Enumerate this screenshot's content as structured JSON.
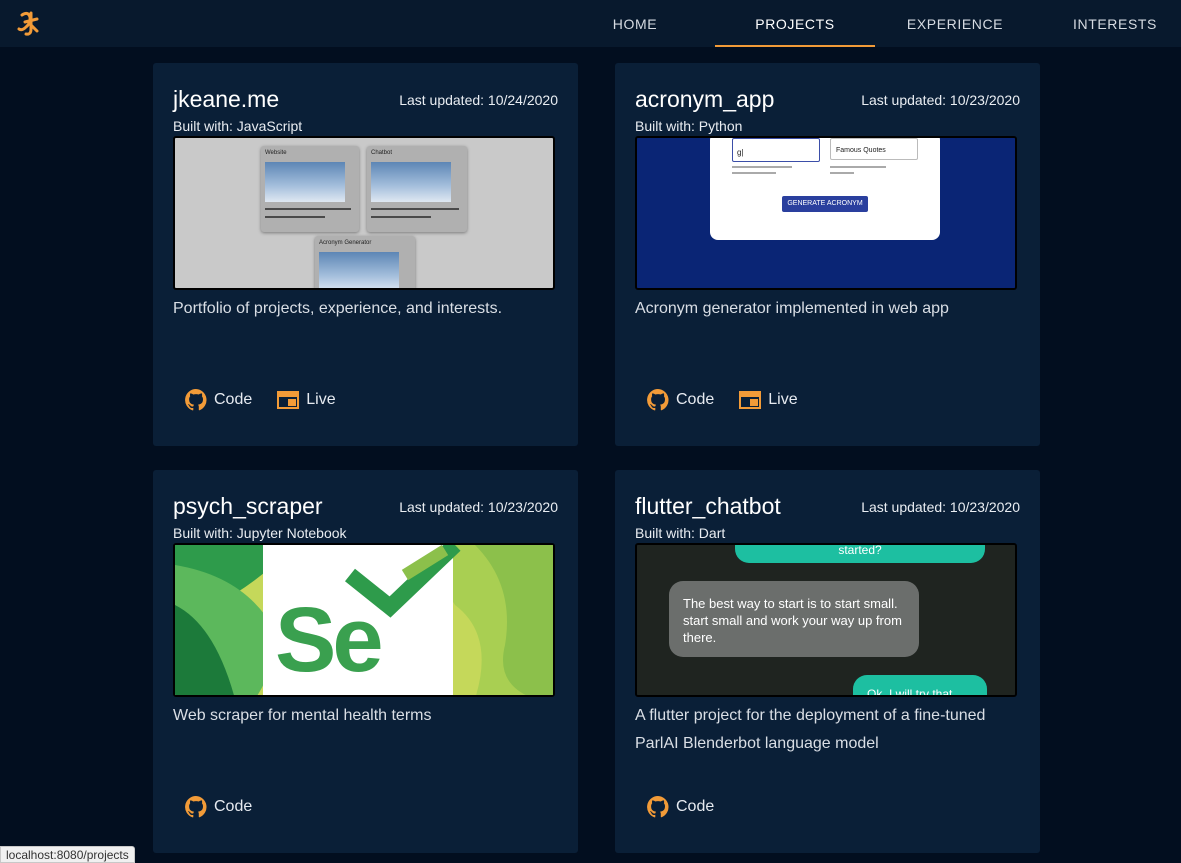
{
  "nav": {
    "tabs": [
      {
        "label": "HOME"
      },
      {
        "label": "PROJECTS"
      },
      {
        "label": "EXPERIENCE"
      },
      {
        "label": "INTERESTS"
      }
    ],
    "active_tab": "PROJECTS",
    "accent_color": "#f29b38"
  },
  "projects": [
    {
      "title": "jkeane.me",
      "updated": "Last updated: 10/24/2020",
      "built": "Built with: JavaScript",
      "description": "Portfolio of projects, experience, and interests.",
      "links": [
        {
          "icon": "github-icon",
          "label": "Code"
        },
        {
          "icon": "browser-window-icon",
          "label": "Live"
        }
      ]
    },
    {
      "title": "acronym_app",
      "updated": "Last updated: 10/23/2020",
      "built": "Built with: Python",
      "description": "Acronym generator implemented in web app",
      "links": [
        {
          "icon": "github-icon",
          "label": "Code"
        },
        {
          "icon": "browser-window-icon",
          "label": "Live"
        }
      ]
    },
    {
      "title": "psych_scraper",
      "updated": "Last updated: 10/23/2020",
      "built": "Built with: Jupyter Notebook",
      "description": "Web scraper for mental health terms",
      "links": [
        {
          "icon": "github-icon",
          "label": "Code"
        }
      ]
    },
    {
      "title": "flutter_chatbot",
      "updated": "Last updated: 10/23/2020",
      "built": "Built with: Dart",
      "description": "A flutter project for the deployment of a fine-tuned ParlAI Blenderbot language model",
      "links": [
        {
          "icon": "github-icon",
          "label": "Code"
        }
      ]
    }
  ],
  "thumbs": {
    "portfolio": {
      "card_a": "Website",
      "card_b": "Chatbot",
      "card_c": "Acronym Generator"
    },
    "acronym": {
      "field_value": "g|",
      "select_value": "Famous Quotes",
      "button": "GENERATE ACRONYM"
    },
    "scraper": {
      "logo_text": "Se"
    },
    "chatbot": {
      "bubble_top": "started?",
      "bubble_main": "The best way to start is to start small. start small and work your way up from there.",
      "bubble_bottom": "Ok, I will try that"
    }
  },
  "status_bar": {
    "url": "localhost:8080/projects"
  }
}
